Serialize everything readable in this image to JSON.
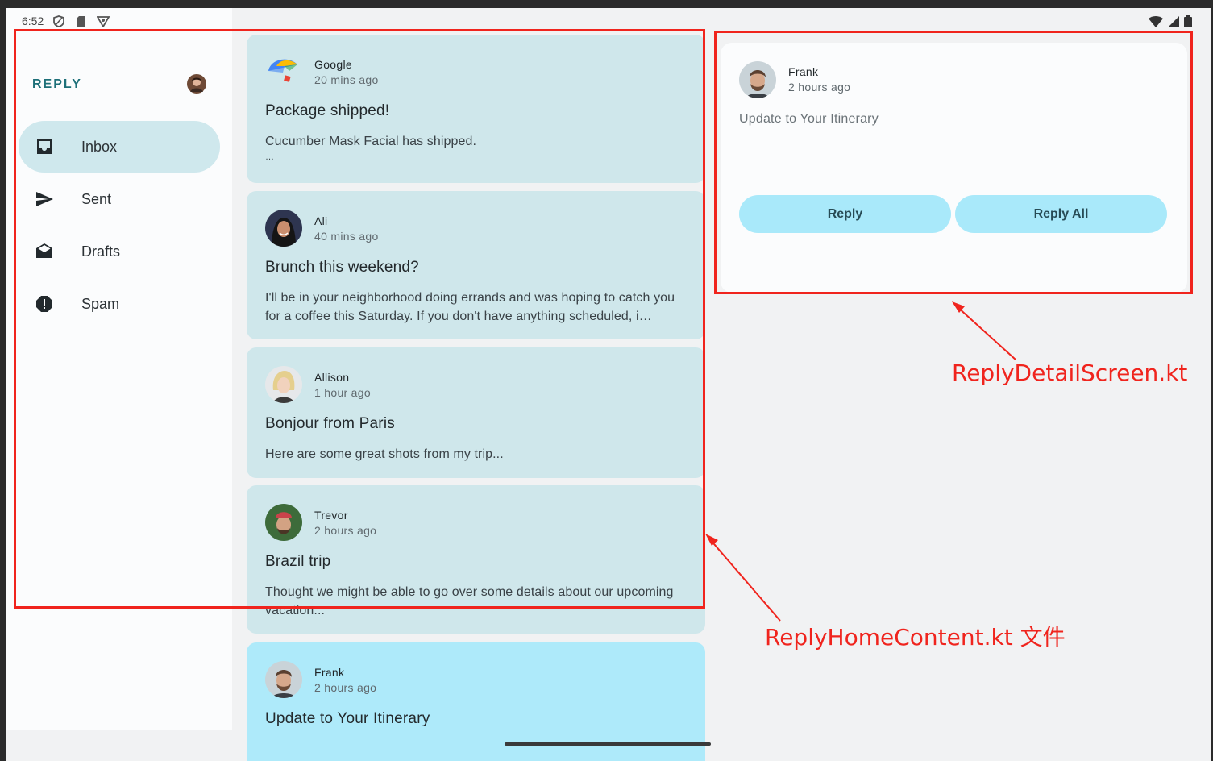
{
  "status_bar": {
    "time": "6:52"
  },
  "app": {
    "brand": "REPLY"
  },
  "nav": {
    "items": [
      {
        "label": "Inbox",
        "icon": "inbox-icon",
        "active": true
      },
      {
        "label": "Sent",
        "icon": "send-icon",
        "active": false
      },
      {
        "label": "Drafts",
        "icon": "drafts-icon",
        "active": false
      },
      {
        "label": "Spam",
        "icon": "report-icon",
        "active": false
      }
    ]
  },
  "emails": [
    {
      "sender": "Google",
      "time": "20 mins ago",
      "subject": "Package shipped!",
      "body": "Cucumber Mask Facial has shipped.",
      "body2": "…"
    },
    {
      "sender": "Ali",
      "time": "40 mins ago",
      "subject": "Brunch this weekend?",
      "body": "I'll be in your neighborhood doing errands and was hoping to catch you for a coffee this Saturday. If you don't have anything scheduled, i…"
    },
    {
      "sender": "Allison",
      "time": "1 hour ago",
      "subject": "Bonjour from Paris",
      "body": "Here are some great shots from my trip..."
    },
    {
      "sender": "Trevor",
      "time": "2 hours ago",
      "subject": "Brazil trip",
      "body": "Thought we might be able to go over some details about our upcoming vacation..."
    },
    {
      "sender": "Frank",
      "time": "2 hours ago",
      "subject": "Update to Your Itinerary",
      "body": ""
    }
  ],
  "detail": {
    "sender": "Frank",
    "time": "2 hours ago",
    "subject": "Update to Your Itinerary",
    "reply_label": "Reply",
    "reply_all_label": "Reply All"
  },
  "annotations": {
    "detail_label": "ReplyDetailScreen.kt",
    "home_label": "ReplyHomeContent.kt 文件"
  },
  "colors": {
    "accent": "#1d6f78",
    "card": "#cfe7eb",
    "card_selected": "#aeeafa",
    "button": "#a9e9fa",
    "annotation": "#f0241d"
  }
}
